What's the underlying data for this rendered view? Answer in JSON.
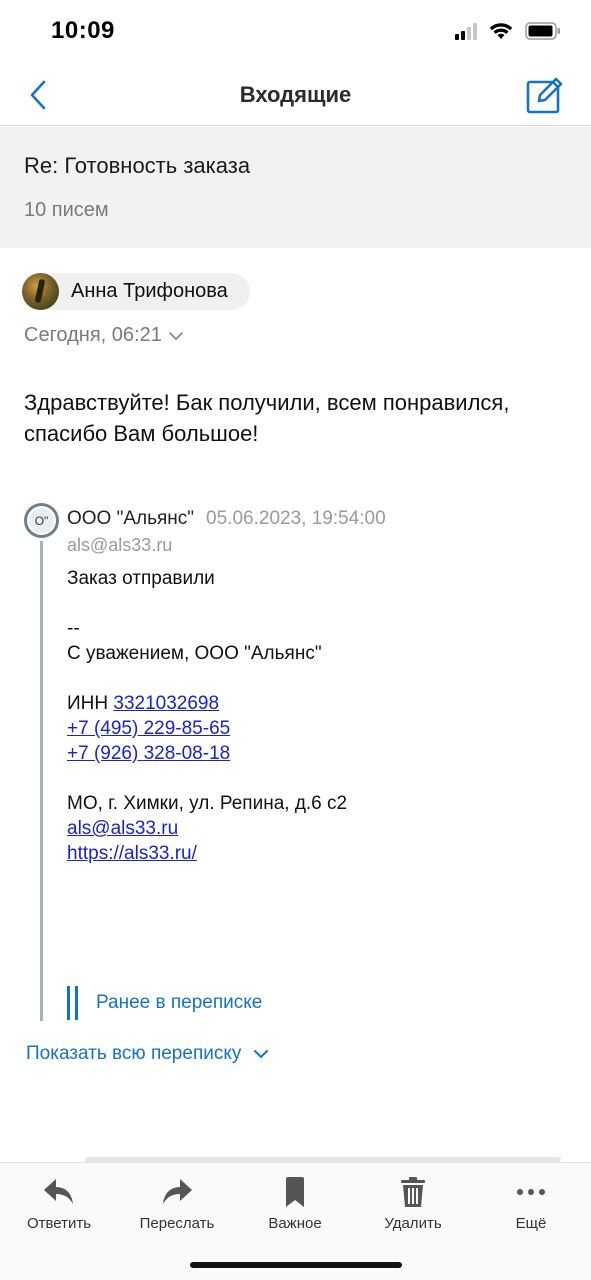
{
  "status": {
    "time": "10:09"
  },
  "nav": {
    "title": "Входящие",
    "back_icon": "chevron-left-icon",
    "compose_icon": "compose-icon"
  },
  "thread": {
    "subject": "Re: Готовность заказа",
    "count": "10 писем"
  },
  "message": {
    "sender": "Анна Трифонова",
    "date": "Сегодня, 06:21",
    "body_lines": [
      "Здравствуйте! Бак получили, всем понравился,",
      "спасибо Вам большое!"
    ]
  },
  "quoted": {
    "avatar_initials": "О\"",
    "sender": "ООО \"Альянс\"",
    "date": "05.06.2023, 19:54:00",
    "email": "als@als33.ru",
    "line1": "Заказ отправили",
    "sig_dash": "--",
    "sig_regards": "С уважением, ООО \"Альянс\"",
    "inn_label": "ИНН ",
    "inn": "3321032698",
    "phone1": "+7 (495) 229-85-65",
    "phone2": "+7 (926) 328-08-18",
    "address": "МО, г. Химки, ул. Репина, д.6 с2",
    "email_link": "als@als33.ru",
    "site": "https://als33.ru/"
  },
  "earlier_label": "Ранее в переписке",
  "show_all_label": "Показать всю переписку",
  "toolbar": {
    "reply": "Ответить",
    "forward": "Переслать",
    "important": "Важное",
    "delete": "Удалить",
    "more": "Ещё"
  },
  "colors": {
    "accent": "#1673c4",
    "link": "#1a22cc"
  }
}
